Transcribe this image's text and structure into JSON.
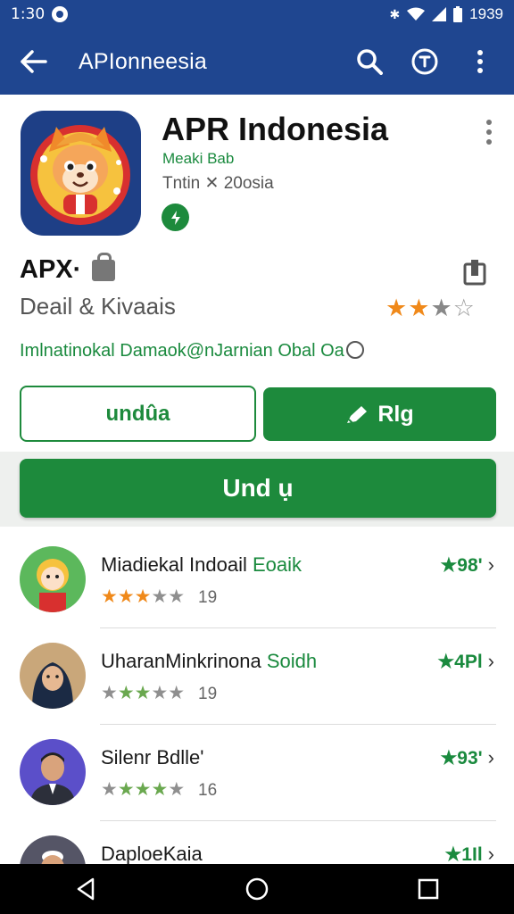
{
  "status": {
    "time": "1:30",
    "battery_time": "1939"
  },
  "appbar": {
    "title": "APIonneesia"
  },
  "app": {
    "name": "APR Indonesia",
    "developer": "Meaki Bab",
    "subtitle": "Tntin ✕ 20osia",
    "apx": "APX·",
    "category": "Deail & Kivaais",
    "rating_stars": [
      "★",
      "★",
      "★",
      "☆"
    ],
    "tagline": "Imlnatinokal Damaok@nJarnian Obal Oa",
    "btn_outline": "undûa",
    "btn_fill": "Rlg",
    "btn_big": "Und ụ"
  },
  "list": [
    {
      "name": "Miadiekal Indoail",
      "name_hl": " Eoaik",
      "stars": "★★★★★",
      "count": "19",
      "score": "★98'",
      "avatar": "cartoon-girl"
    },
    {
      "name": "UharanMinkrinona",
      "name_hl": " Soidh",
      "stars": "★★★★★",
      "count": "19",
      "score": "★4Pl",
      "avatar": "woman-hijab"
    },
    {
      "name": "Silenr Bdlle'",
      "name_hl": "",
      "stars": "★★★★★",
      "count": "16",
      "score": "★93'",
      "avatar": "man-suit"
    },
    {
      "name": "DaploeKaia",
      "name_hl": "",
      "stars": "★★★★★",
      "count": "",
      "score": "★1Il",
      "avatar": "man-cap"
    }
  ],
  "colors": {
    "primary": "#1f4690",
    "accent": "#1d8a3c",
    "star": "#f0891a"
  },
  "icons": [
    "back-arrow-icon",
    "search-icon",
    "coin-icon",
    "more-vert-icon",
    "verified-icon",
    "lock-icon",
    "bookmark-icon",
    "pen-icon",
    "chevron-right-icon",
    "nav-back-icon",
    "nav-home-icon",
    "nav-recents-icon"
  ]
}
